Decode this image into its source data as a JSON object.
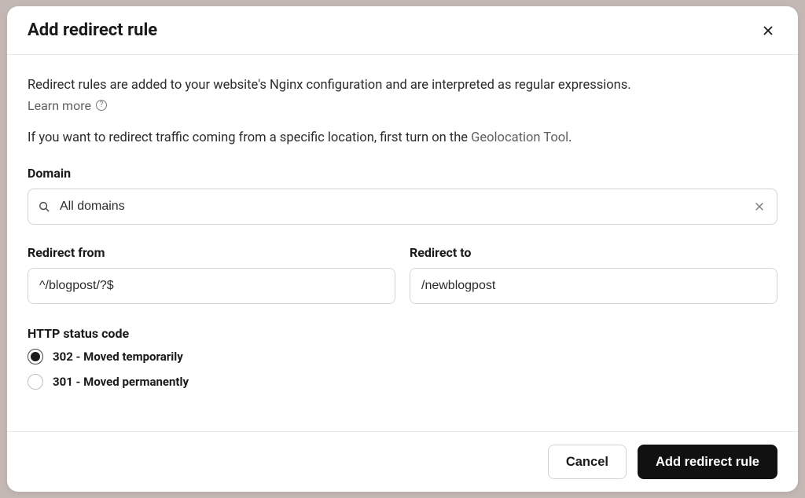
{
  "modal": {
    "title": "Add redirect rule",
    "intro": "Redirect rules are added to your website's Nginx configuration and are interpreted as regular expressions.",
    "learn_more": "Learn more",
    "geo_prefix": "If you want to redirect traffic coming from a specific location, first turn on the ",
    "geo_link": "Geolocation Tool",
    "geo_suffix": "."
  },
  "domain": {
    "label": "Domain",
    "value": "All domains"
  },
  "redirect_from": {
    "label": "Redirect from",
    "value": "^/blogpost/?$"
  },
  "redirect_to": {
    "label": "Redirect to",
    "value": "/newblogpost"
  },
  "http_status": {
    "label": "HTTP status code",
    "options": [
      {
        "value": "302",
        "label": "302 - Moved temporarily",
        "selected": true
      },
      {
        "value": "301",
        "label": "301 - Moved permanently",
        "selected": false
      }
    ]
  },
  "footer": {
    "cancel": "Cancel",
    "submit": "Add redirect rule"
  }
}
